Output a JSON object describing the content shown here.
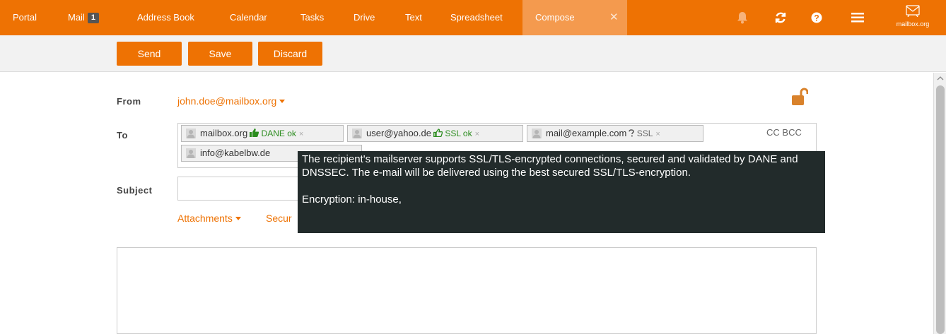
{
  "nav": {
    "items": [
      "Portal",
      "Mail",
      "Address Book",
      "Calendar",
      "Tasks",
      "Drive",
      "Text",
      "Spreadsheet",
      "Compose"
    ],
    "mail_badge": "1",
    "close_symbol": "✕",
    "logo_text": "mailbox.org",
    "icons": [
      "bell-icon",
      "refresh-icon",
      "help-icon",
      "menu-icon",
      "mailbox-logo-icon"
    ]
  },
  "toolbar": {
    "send": "Send",
    "save": "Save",
    "discard": "Discard"
  },
  "form": {
    "from_label": "From",
    "from_value": "john.doe@mailbox.org",
    "to_label": "To",
    "cc": "CC",
    "bcc": "BCC",
    "subject_label": "Subject",
    "attachments": "Attachments",
    "security_partial": "Secur"
  },
  "recipients": [
    {
      "address": "mailbox.org",
      "status": "DANE ok",
      "remove": "×"
    },
    {
      "address": "user@yahoo.de",
      "status": "SSL ok",
      "remove": "×"
    },
    {
      "address": "mail@example.com",
      "status": "SSL",
      "remove": "×"
    },
    {
      "address": "info@kabelbw.de"
    }
  ],
  "tooltip": {
    "text": "The recipient's mailserver supports SSL/TLS-encrypted connections, secured and validated by DANE and DNSSEC. The e-mail will be delivered using the best secured SSL/TLS-encryption.",
    "encryption": "Encryption: in-house,"
  },
  "colors": {
    "accent": "#ee7203",
    "ok": "#2b8c1e",
    "tooltip_bg": "#222b2b"
  }
}
